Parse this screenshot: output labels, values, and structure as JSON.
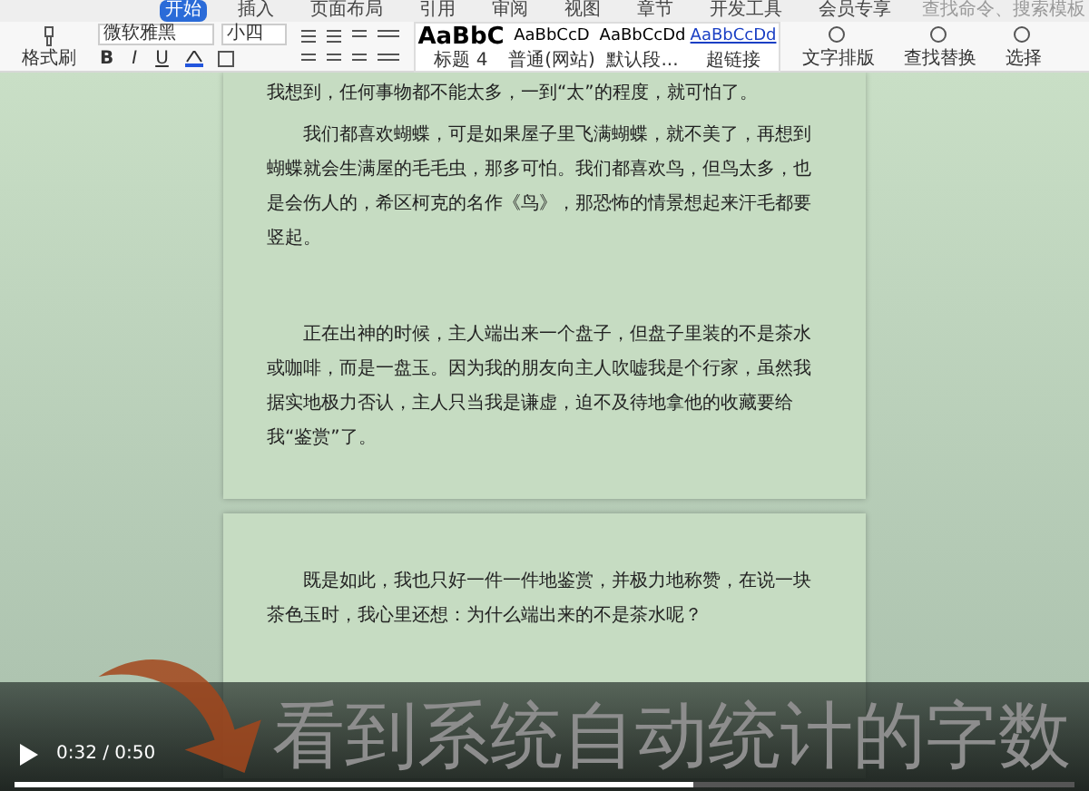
{
  "menu_tabs": [
    {
      "label": "开始",
      "selected": true
    },
    {
      "label": "插入",
      "selected": false
    },
    {
      "label": "页面布局",
      "selected": false
    },
    {
      "label": "引用",
      "selected": false
    },
    {
      "label": "审阅",
      "selected": false
    },
    {
      "label": "视图",
      "selected": false
    },
    {
      "label": "章节",
      "selected": false
    },
    {
      "label": "开发工具",
      "selected": false
    },
    {
      "label": "会员专享",
      "selected": false
    }
  ],
  "command_search": {
    "placeholder": "查找命令、搜索模板"
  },
  "ribbon": {
    "format_painter": "格式刷",
    "font_name": "微软雅黑",
    "font_size": "小四",
    "format_buttons": [
      "B",
      "I",
      "U"
    ],
    "styles": [
      {
        "sample": "AaBbC",
        "name": "标题 4",
        "kind": "heading"
      },
      {
        "sample": "AaBbCcD",
        "name": "普通(网站)",
        "kind": "normal"
      },
      {
        "sample": "AaBbCcDd",
        "name": "默认段...",
        "kind": "normal"
      },
      {
        "sample": "AaBbCcDd",
        "name": "超链接",
        "kind": "link"
      }
    ],
    "tools": [
      "文字排版",
      "查找替换",
      "选择"
    ]
  },
  "pages": [
    {
      "paragraphs": [
        {
          "text": "我想到，任何事物都不能太多，一到“太”的程度，就可怕了。",
          "indent": false
        },
        {
          "text": "我们都喜欢蝴蝶，可是如果屋子里飞满蝴蝶，就不美了，再想到蝴蝶就会生满屋的毛毛虫，那多可怕。我们都喜欢鸟，但鸟太多，也是会伤人的，希区柯克的名作《鸟》，那恐怖的情景想起来汗毛都要竖起。",
          "indent": true
        },
        {
          "text": "正在出神的时候，主人端出来一个盘子，但盘子里装的不是茶水或咖啡，而是一盘玉。因为我的朋友向主人吹嘘我是个行家，虽然我据实地极力否认，主人只当我是谦虚，迫不及待地拿他的收藏要给我“鉴赏”了。",
          "indent": true
        }
      ]
    },
    {
      "paragraphs": [
        {
          "text": "既是如此，我也只好一件一件地鉴赏，并极力地称赞，在说一块茶色玉时，我心里还想：为什么端出来的不是茶水呢？",
          "indent": true
        }
      ]
    }
  ],
  "subtitle": "看到系统自动统计的字数",
  "player": {
    "time": "0:32 / 0:50",
    "playing": false,
    "level": 0.64
  }
}
